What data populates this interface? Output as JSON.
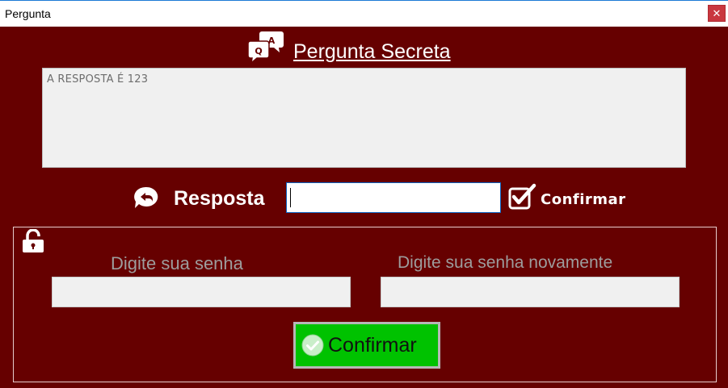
{
  "window": {
    "title": "Pergunta",
    "close_glyph": "✕"
  },
  "header": {
    "icon": "qa-chat-icon",
    "title": "Pergunta Secreta"
  },
  "question": {
    "text": "A RESPOSTA É 123"
  },
  "answer": {
    "icon": "reply-bubble-icon",
    "label": "Resposta",
    "value": "",
    "confirm_icon": "checkbox-check-icon",
    "confirm_label": "Confirmar"
  },
  "password": {
    "lock_icon": "unlocked-padlock-icon",
    "new_label": "Digite sua senha",
    "repeat_label": "Digite sua senha novamente",
    "new_value": "",
    "repeat_value": "",
    "confirm_icon": "check-circle-icon",
    "confirm_label": "Confirmar"
  },
  "colors": {
    "background": "#660000",
    "button_green": "#00c200",
    "field_gray": "#f0f0f0",
    "label_gray": "#9d9d9d",
    "close_red": "#c9373f"
  }
}
